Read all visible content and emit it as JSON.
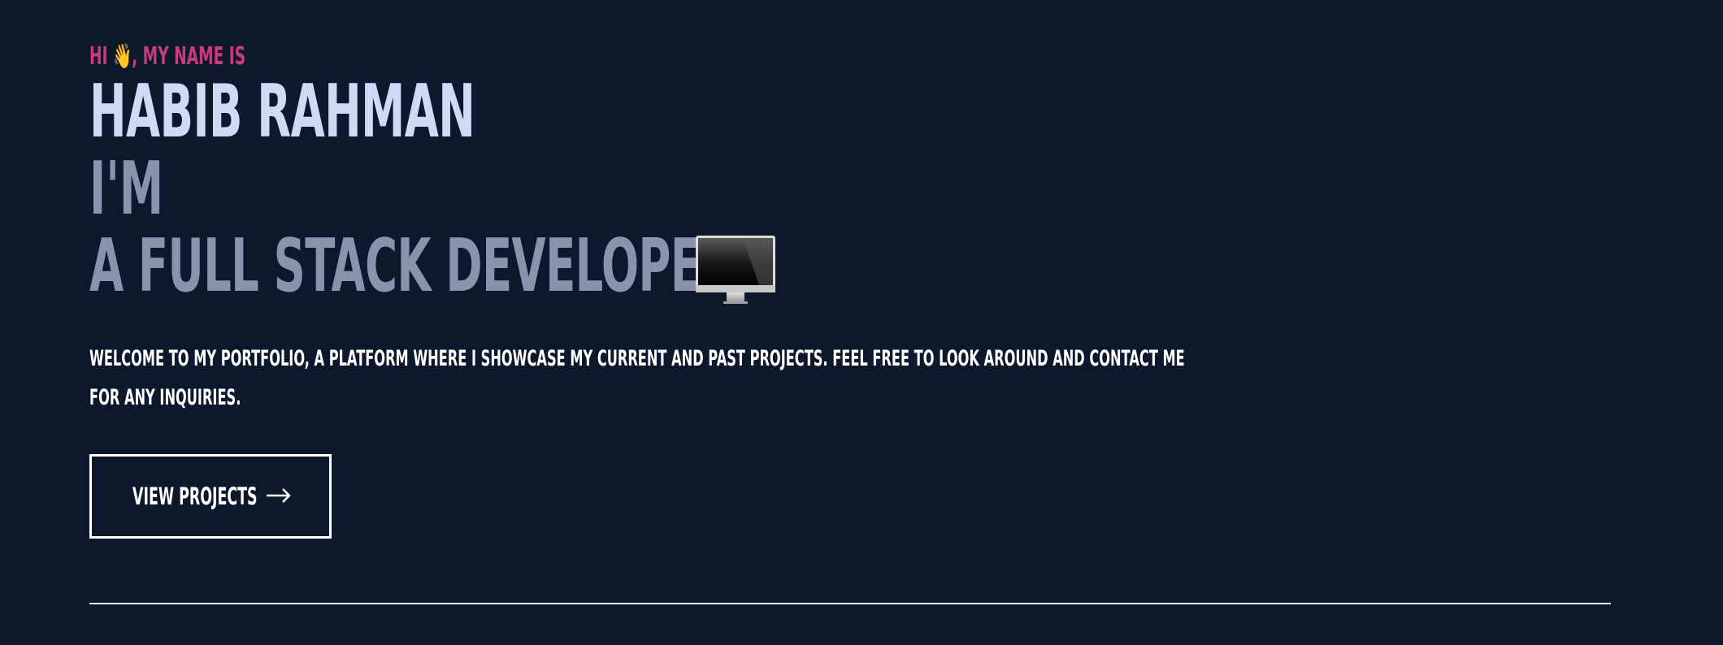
{
  "hero": {
    "greeting_prefix": "HI",
    "greeting_emoji": "👋",
    "greeting_suffix": ", MY NAME IS",
    "name": "HABIB RAHMAN",
    "im": "I'M",
    "role": "A FULL STACK DEVELOPER",
    "role_icon": "desktop-computer-icon",
    "intro_line1": "WELCOME TO MY PORTFOLIO, A PLATFORM WHERE I SHOWCASE MY CURRENT AND PAST PROJECTS. FEEL FREE TO LOOK AROUND AND CONTACT ME",
    "intro_line2": "FOR ANY INQUIRIES.",
    "cta_label": "VIEW PROJECTS",
    "cta_icon": "arrow-right-icon"
  },
  "colors": {
    "background": "#0e182d",
    "greeting": "#c73c7c",
    "name": "#d2d9f5",
    "role": "#8a93ab",
    "text": "#ffffff"
  }
}
